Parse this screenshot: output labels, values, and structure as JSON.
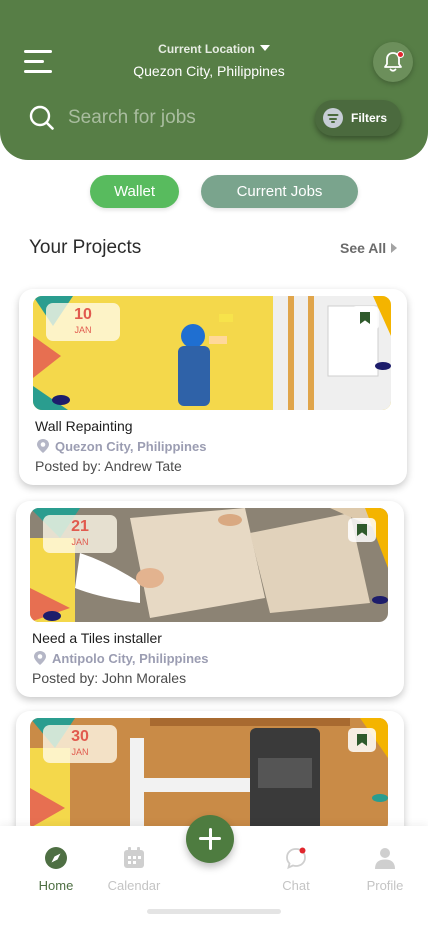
{
  "header": {
    "location_label": "Current Location",
    "location_value": "Quezon City, Philippines",
    "search_placeholder": "Search for jobs",
    "filters_label": "Filters"
  },
  "pills": {
    "wallet": "Wallet",
    "current_jobs": "Current Jobs"
  },
  "section": {
    "title": "Your Projects",
    "see_all": "See All"
  },
  "projects": [
    {
      "day": "10",
      "month": "JAN",
      "title": "Wall Repainting",
      "location": "Quezon City, Philippines",
      "posted_by": "Posted by: Andrew Tate"
    },
    {
      "day": "21",
      "month": "JAN",
      "title": "Need a Tiles installer",
      "location": "Antipolo City, Philippines",
      "posted_by": "Posted by: John Morales"
    },
    {
      "day": "30",
      "month": "JAN",
      "title": "",
      "location": "",
      "posted_by": ""
    }
  ],
  "nav": {
    "home": "Home",
    "calendar": "Calendar",
    "chat": "Chat",
    "profile": "Profile"
  },
  "colors": {
    "brand_green": "#577e46",
    "wallet_green": "#58bb5e",
    "jobs_green": "#7aa48d",
    "date_red": "#e15a4e",
    "notification_red": "#e0262d"
  }
}
